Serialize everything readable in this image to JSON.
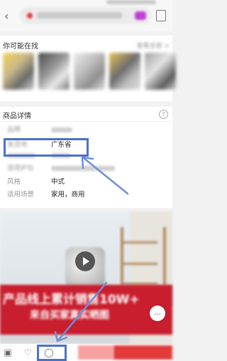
{
  "header": {
    "back_icon": "chevron-left-icon",
    "bag_icon": "shopping-bag-icon"
  },
  "maybe_in": {
    "title": "你可能在找",
    "view_all": "查看全部 >"
  },
  "details": {
    "title": "商品详情",
    "help_icon": "question-icon",
    "rows": [
      {
        "key": "品牌",
        "value": ""
      },
      {
        "key": "发货地",
        "value": "广东省"
      },
      {
        "key": "",
        "value": ""
      },
      {
        "key": "适用护社",
        "value": ""
      },
      {
        "key": "风格",
        "value": "中式"
      },
      {
        "key": "适用场景",
        "value": "家用，商用"
      }
    ]
  },
  "media": {
    "banner_line1": "产品线上累计销售10W+",
    "banner_line2": "来自买家真实晒图",
    "play_icon": "play-icon",
    "chat_icon": "chat-icon"
  },
  "bottom_bar": {
    "store_icon": "store-icon",
    "favorite_icon": "heart-icon",
    "service_icon": "chat-bubble-icon"
  },
  "colors": {
    "annotation": "#4a72c9",
    "buy": "#e33a3a",
    "banner": "#c81e2e"
  }
}
